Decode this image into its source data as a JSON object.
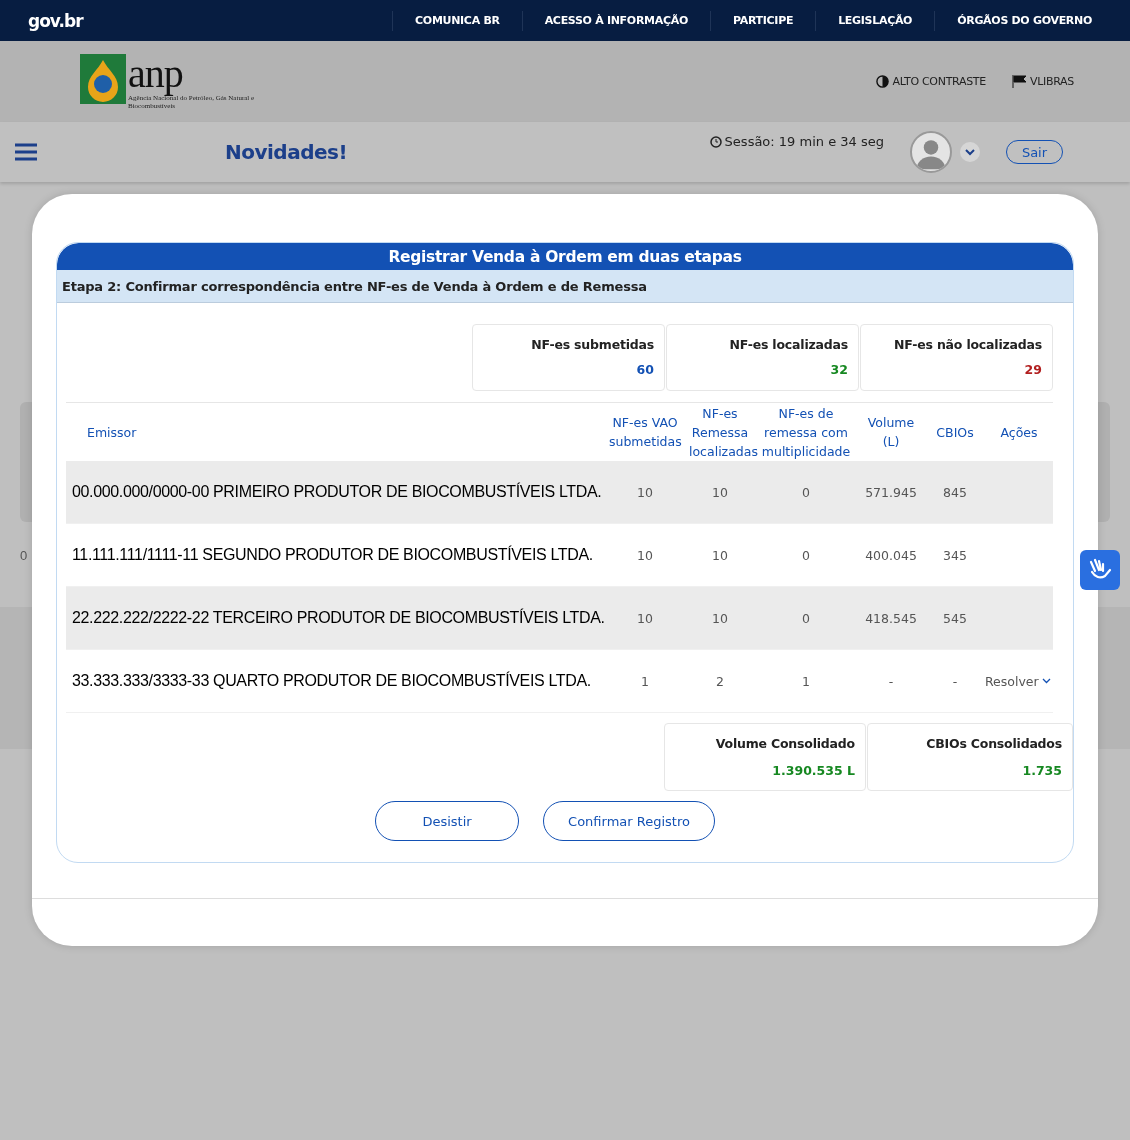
{
  "topbar": {
    "logo": "gov.br",
    "links": [
      "COMUNICA BR",
      "ACESSO À INFORMAÇÃO",
      "PARTICIPE",
      "LEGISLAÇÃO",
      "ÓRGÃOS DO GOVERNO"
    ]
  },
  "header": {
    "logo_text": "anp",
    "logo_subtitle": "Agência Nacional do Petróleo, Gás Natural e Biocombustíveis",
    "tools": [
      "ALTO CONTRASTE",
      "VLIBRAS"
    ]
  },
  "nav": {
    "title": "Novidades!",
    "session": "Sessão: 19 min e 34 seg",
    "logout": "Sair"
  },
  "background": {
    "texts": [
      "0"
    ]
  },
  "modal": {
    "title": "Registrar Venda à Ordem em duas etapas",
    "step": "Etapa 2: Confirmar correspondência entre NF-es de Venda à Ordem e de Remessa",
    "summary": [
      {
        "label": "NF-es submetidas",
        "value": "60",
        "color": "#1351b4"
      },
      {
        "label": "NF-es localizadas",
        "value": "32",
        "color": "#168821"
      },
      {
        "label": "NF-es não localizadas",
        "value": "29",
        "color": "#b21f1f"
      }
    ],
    "table": {
      "columns": [
        "Emissor",
        "NF-es VAO submetidas",
        "NF-es Remessa localizadas",
        "NF-es de remessa com multiplicidade",
        "Volume (L)",
        "CBIOs",
        "Ações"
      ],
      "rows": [
        {
          "cells": [
            "00.000.000/0000-00 PRIMEIRO PRODUTOR DE BIOCOMBUSTÍVEIS LTDA.",
            "10",
            "10",
            "0",
            "571.945",
            "845"
          ]
        },
        {
          "cells": [
            "11.111.111/1111-11 SEGUNDO PRODUTOR DE BIOCOMBUSTÍVEIS LTDA.",
            "10",
            "10",
            "0",
            "400.045",
            "345"
          ]
        },
        {
          "cells": [
            "22.222.222/2222-22 TERCEIRO PRODUTOR DE BIOCOMBUSTÍVEIS LTDA.",
            "10",
            "10",
            "0",
            "418.545",
            "545"
          ]
        },
        {
          "cells": [
            "33.333.333/3333-33 QUARTO PRODUTOR DE BIOCOMBUSTÍVEIS LTDA.",
            "1",
            "2",
            "1",
            "-",
            "-"
          ],
          "action": "Resolver"
        }
      ]
    },
    "totals": [
      {
        "label": "Volume Consolidado",
        "value": "1.390.535 L",
        "color": "#168821"
      },
      {
        "label": "CBIOs Consolidados",
        "value": "1.735",
        "color": "#168821"
      }
    ],
    "buttons": [
      "Desistir",
      "Confirmar Registro"
    ]
  }
}
